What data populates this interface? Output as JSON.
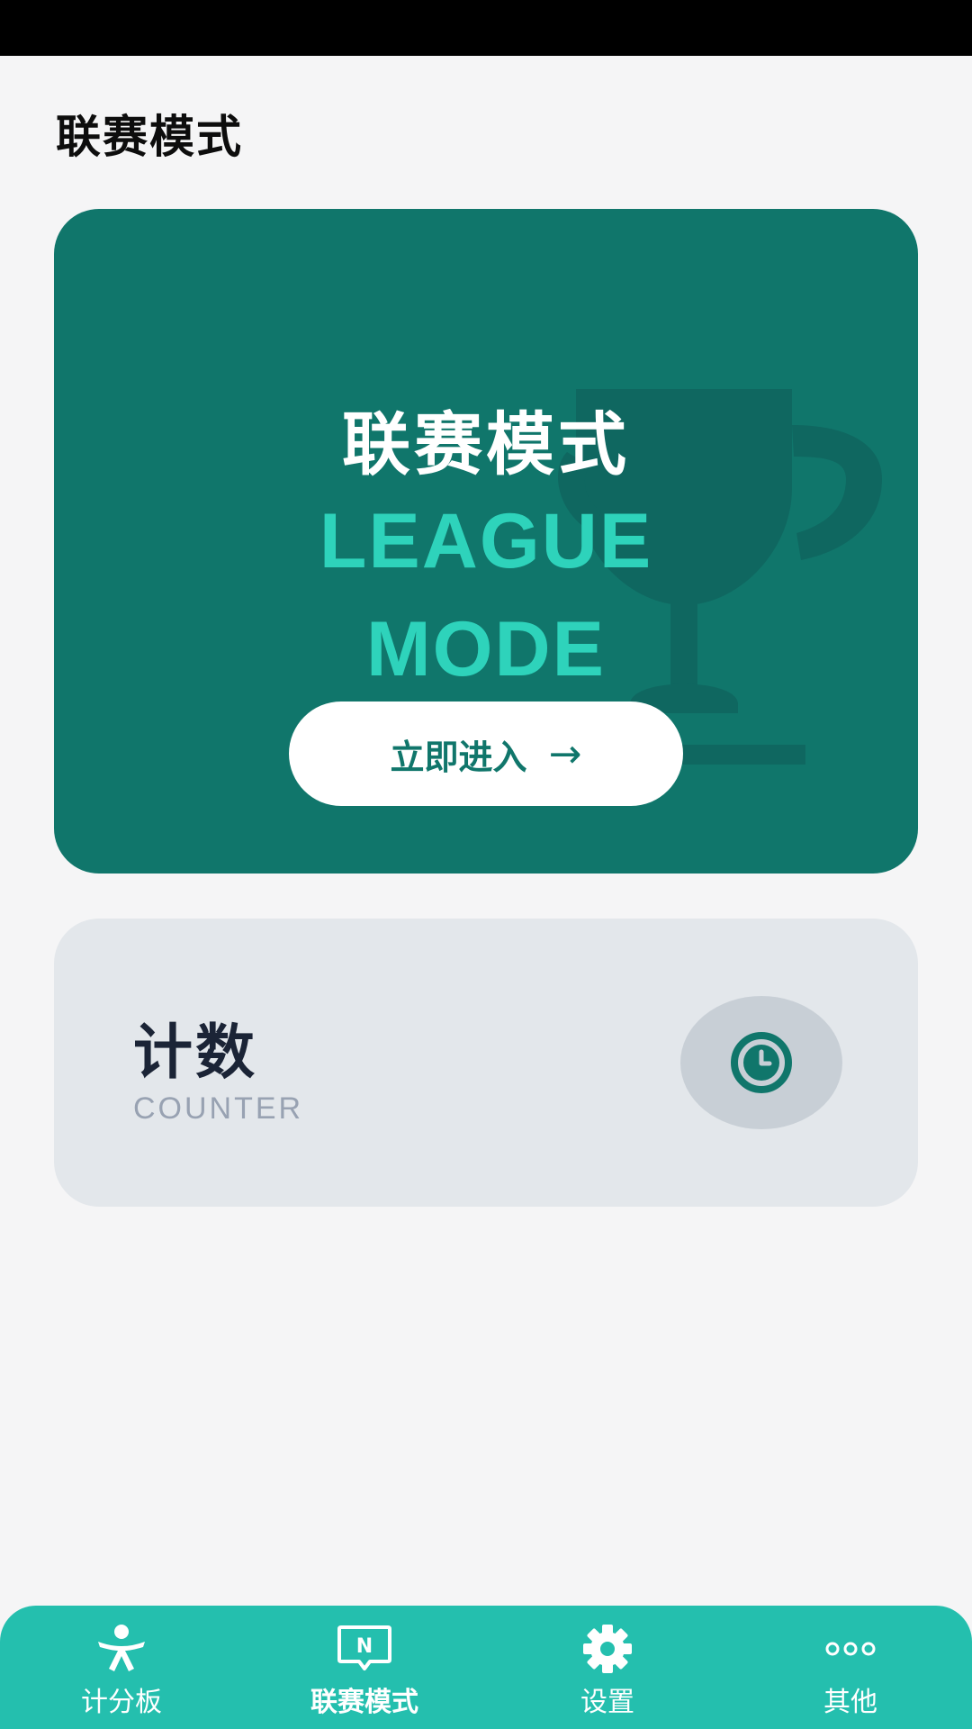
{
  "header": {
    "title": "联赛模式"
  },
  "league_card": {
    "title": "联赛模式",
    "subtitle_line1": "LEAGUE",
    "subtitle_line2": "MODE",
    "button_label": "立即进入",
    "button_arrow": "→",
    "background_color": "#10766b",
    "accent_color": "#2ed3bb",
    "icon": "trophy-icon"
  },
  "counter_card": {
    "title": "计数",
    "subtitle": "COUNTER",
    "icon": "clock-icon"
  },
  "bottom_nav": {
    "background_color": "#24bfae",
    "items": [
      {
        "label": "计分板",
        "icon": "person-icon",
        "active": false
      },
      {
        "label": "联赛模式",
        "icon": "message-n-icon",
        "active": true
      },
      {
        "label": "设置",
        "icon": "gear-icon",
        "active": false
      },
      {
        "label": "其他",
        "icon": "more-icon",
        "active": false
      }
    ]
  }
}
